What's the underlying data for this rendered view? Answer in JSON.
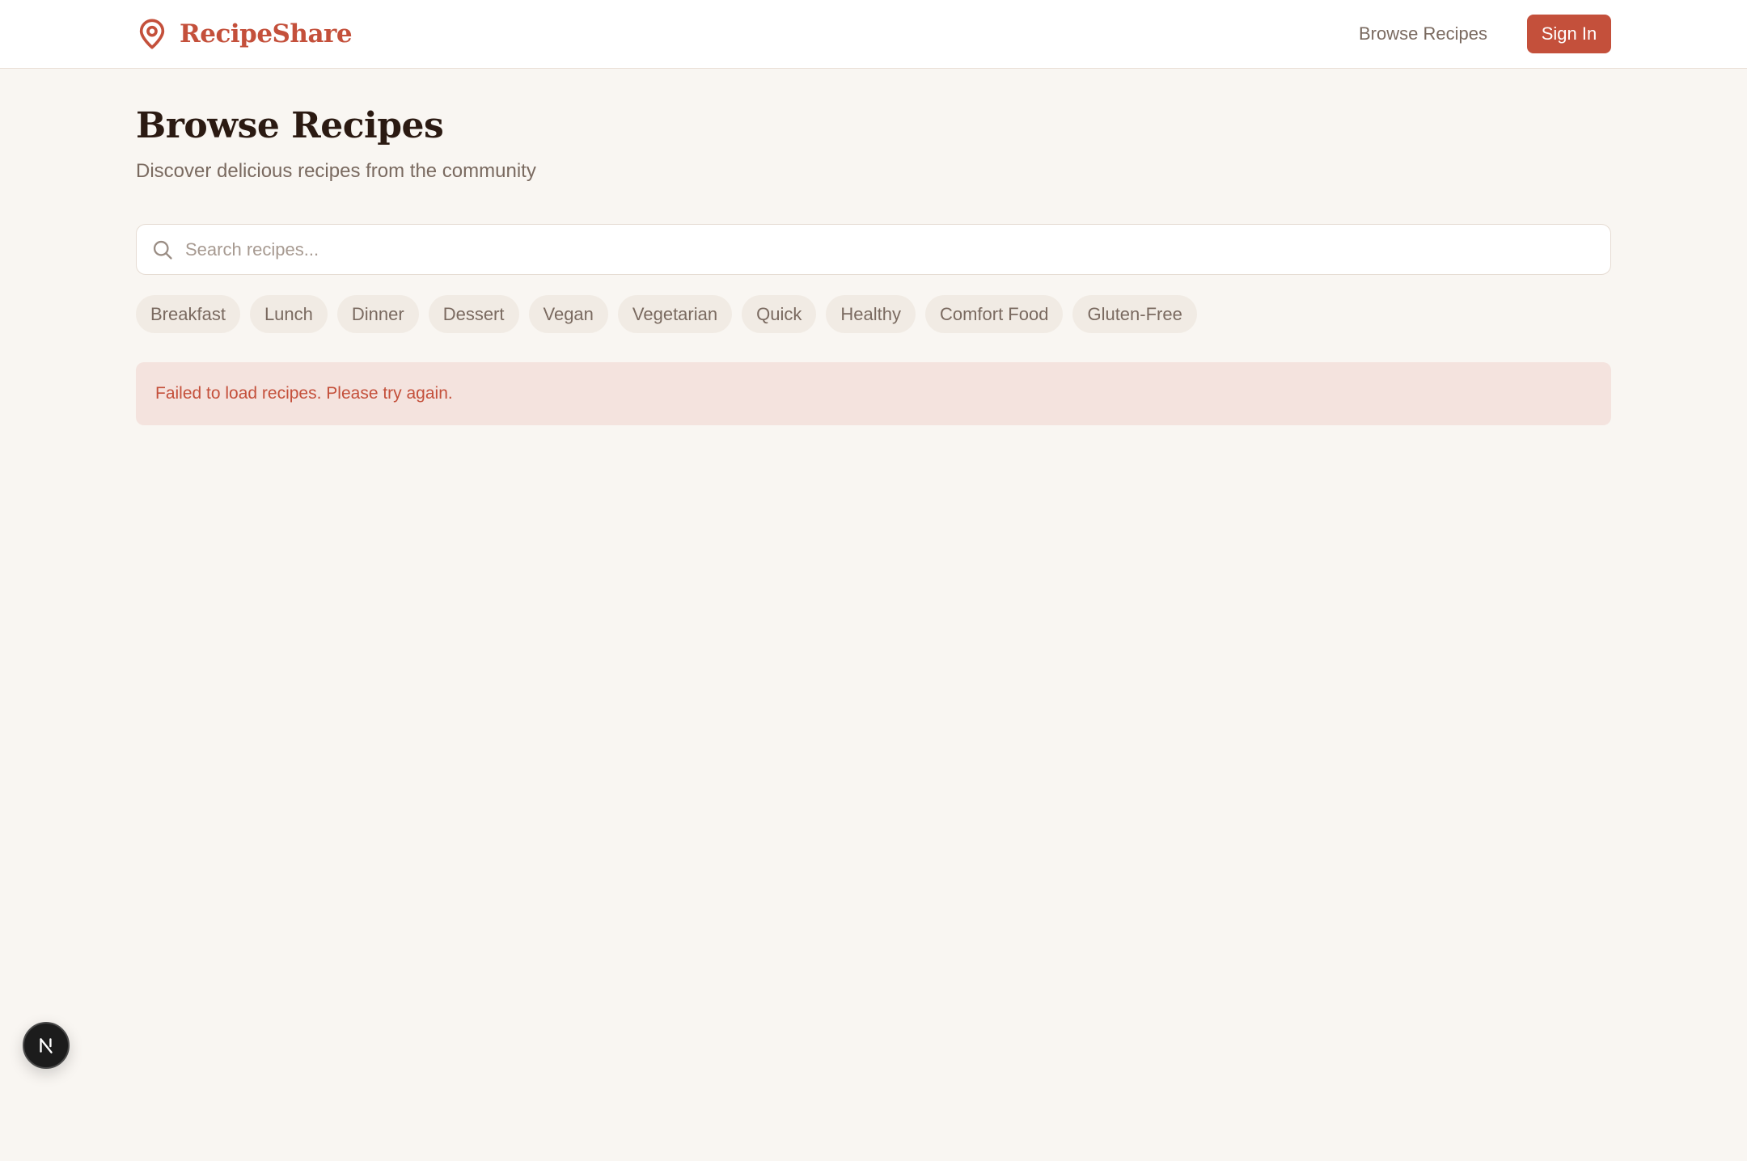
{
  "header": {
    "brand_name": "RecipeShare",
    "brand_icon": "map-pin-icon",
    "nav_browse": "Browse Recipes",
    "sign_in": "Sign In"
  },
  "page": {
    "title": "Browse Recipes",
    "subtitle": "Discover delicious recipes from the community"
  },
  "search": {
    "placeholder": "Search recipes...",
    "value": "",
    "icon": "search-icon"
  },
  "categories": [
    "Breakfast",
    "Lunch",
    "Dinner",
    "Dessert",
    "Vegan",
    "Vegetarian",
    "Quick",
    "Healthy",
    "Comfort Food",
    "Gluten-Free"
  ],
  "error": {
    "message": "Failed to load recipes. Please try again."
  },
  "dev_badge": {
    "letter": "N"
  },
  "colors": {
    "accent": "#c4503b",
    "background": "#f9f6f2",
    "chip_bg": "#f1ebe4",
    "error_bg": "#f4e3de",
    "title_text": "#2b1a12",
    "muted_text": "#7a6a60"
  }
}
